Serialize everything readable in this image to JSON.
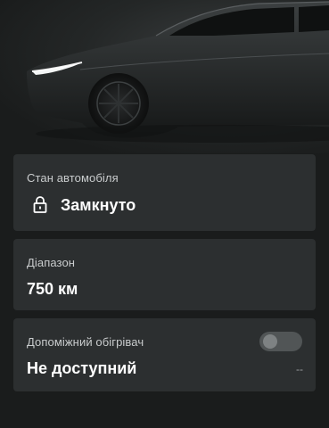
{
  "vehicle_status": {
    "label": "Стан автомобіля",
    "value": "Замкнуто",
    "icon": "lock-icon"
  },
  "range": {
    "label": "Діапазон",
    "value": "750 км"
  },
  "aux_heater": {
    "label": "Допоміжний обігрівач",
    "value": "Не доступний",
    "toggle_on": false,
    "trailing_text": "--"
  },
  "colors": {
    "background": "#1a1c1c",
    "card": "#2c2f30",
    "label": "#c9cccd",
    "value": "#ffffff",
    "toggle_track": "#515556",
    "toggle_knob": "#7e8283"
  }
}
